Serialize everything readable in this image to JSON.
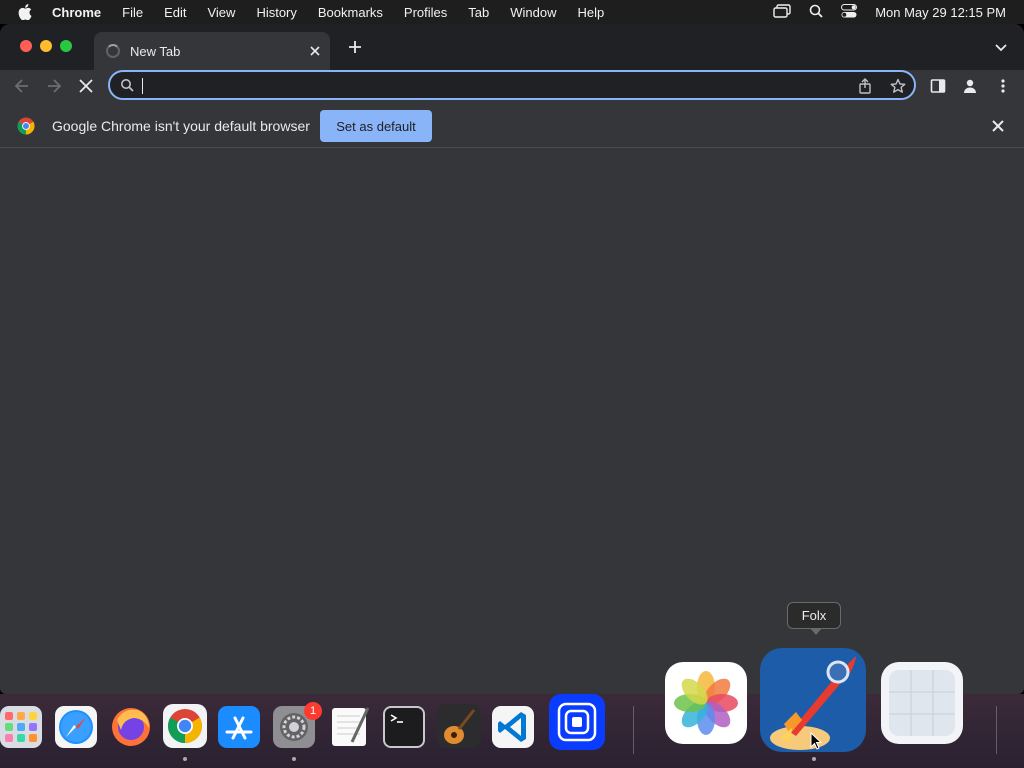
{
  "menubar": {
    "apple_icon": "apple-icon",
    "items": [
      "Chrome",
      "File",
      "Edit",
      "View",
      "History",
      "Bookmarks",
      "Profiles",
      "Tab",
      "Window",
      "Help"
    ],
    "datetime": "Mon May 29  12:15 PM"
  },
  "tabs": [
    {
      "title": "New Tab",
      "loading": true
    }
  ],
  "omnibox": {
    "value": "",
    "placeholder": ""
  },
  "infobar": {
    "message": "Google Chrome isn't your default browser",
    "button_label": "Set as default"
  },
  "dock": {
    "tooltip": "Folx",
    "settings_badge": "1",
    "apps": [
      "launchpad",
      "safari",
      "firefox",
      "chrome",
      "app-store",
      "system-settings",
      "textedit",
      "terminal",
      "garageband",
      "vscode",
      "screens",
      "photos",
      "folx",
      "preview-grid"
    ]
  },
  "colors": {
    "accent": "#8ab4f8",
    "window_bg": "#35363a",
    "tabstrip_bg": "#202124"
  }
}
